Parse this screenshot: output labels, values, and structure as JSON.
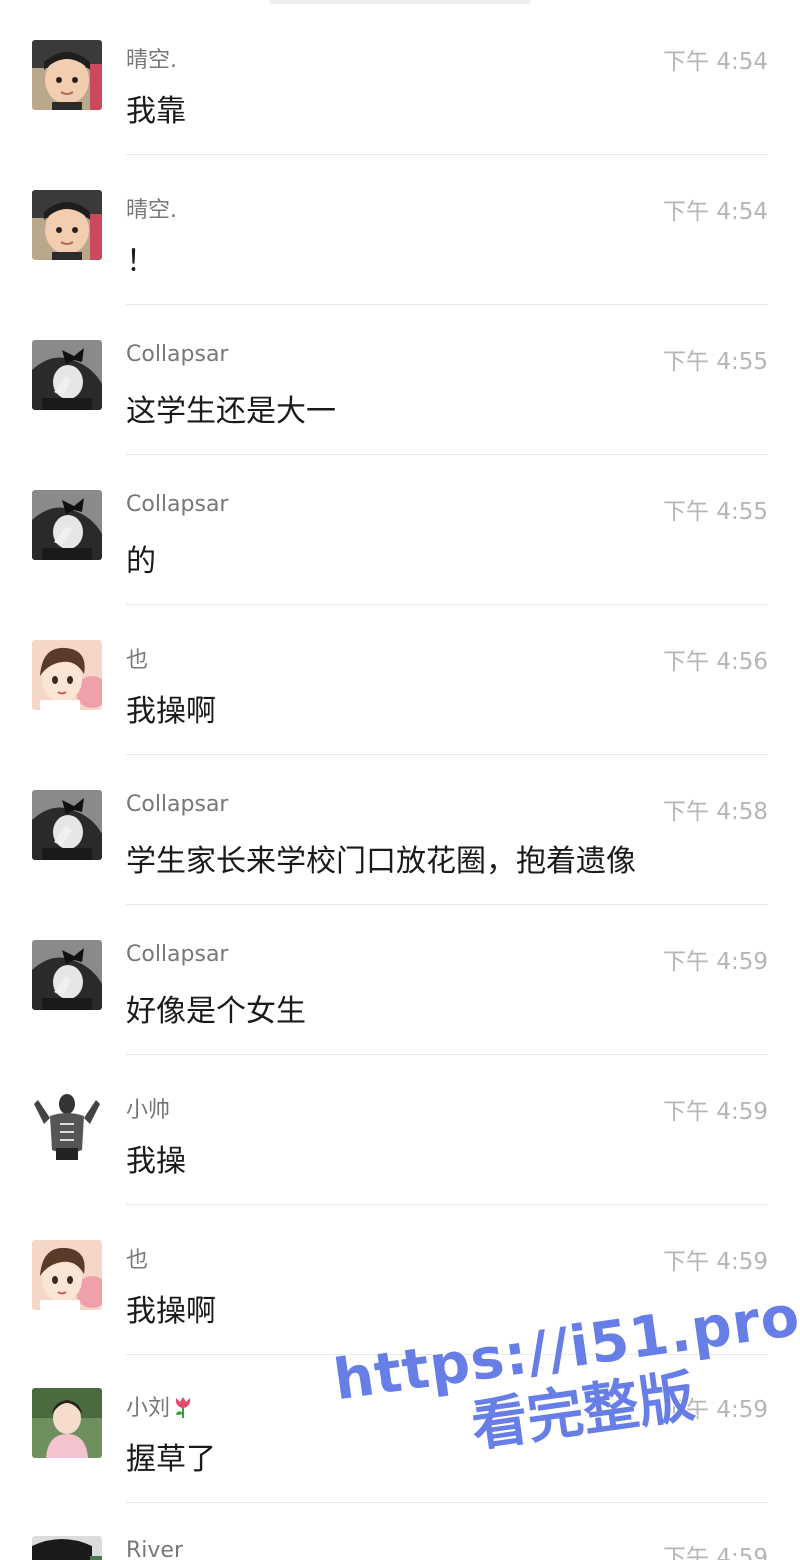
{
  "messages": [
    {
      "sender": "晴空.",
      "time": "下午 4:54",
      "text": "我靠",
      "avatar": "boy-photo-avatar"
    },
    {
      "sender": "晴空.",
      "time": "下午 4:54",
      "text": "！",
      "avatar": "boy-photo-avatar"
    },
    {
      "sender": "Collapsar",
      "time": "下午 4:55",
      "text": "这学生还是大一",
      "avatar": "girl-bow-avatar"
    },
    {
      "sender": "Collapsar",
      "time": "下午 4:55",
      "text": "的",
      "avatar": "girl-bow-avatar"
    },
    {
      "sender": "也",
      "time": "下午 4:56",
      "text": "我操啊",
      "avatar": "anime-girl-avatar"
    },
    {
      "sender": "Collapsar",
      "time": "下午 4:58",
      "text": "学生家长来学校门口放花圈，抱着遗像",
      "avatar": "girl-bow-avatar"
    },
    {
      "sender": "Collapsar",
      "time": "下午 4:59",
      "text": "好像是个女生",
      "avatar": "girl-bow-avatar"
    },
    {
      "sender": "小帅",
      "time": "下午 4:59",
      "text": "我操",
      "avatar": "muscle-man-avatar"
    },
    {
      "sender": "也",
      "time": "下午 4:59",
      "text": "我操啊",
      "avatar": "anime-girl-avatar"
    },
    {
      "sender": "小刘",
      "sender_icon": "tulip-icon",
      "time": "下午 4:59",
      "text": "握草了",
      "avatar": "pink-girl-avatar"
    },
    {
      "sender": "River",
      "time": "下午 4:59",
      "text": "",
      "avatar": "dark-hair-avatar"
    }
  ],
  "watermark": {
    "line1": "https://i51.pro",
    "line2": "看完整版",
    "color": "#5b74e4"
  },
  "colors": {
    "sender": "#777777",
    "time": "#b5b5b5",
    "text": "#1a1a1a",
    "divider": "#e8e8e8"
  }
}
